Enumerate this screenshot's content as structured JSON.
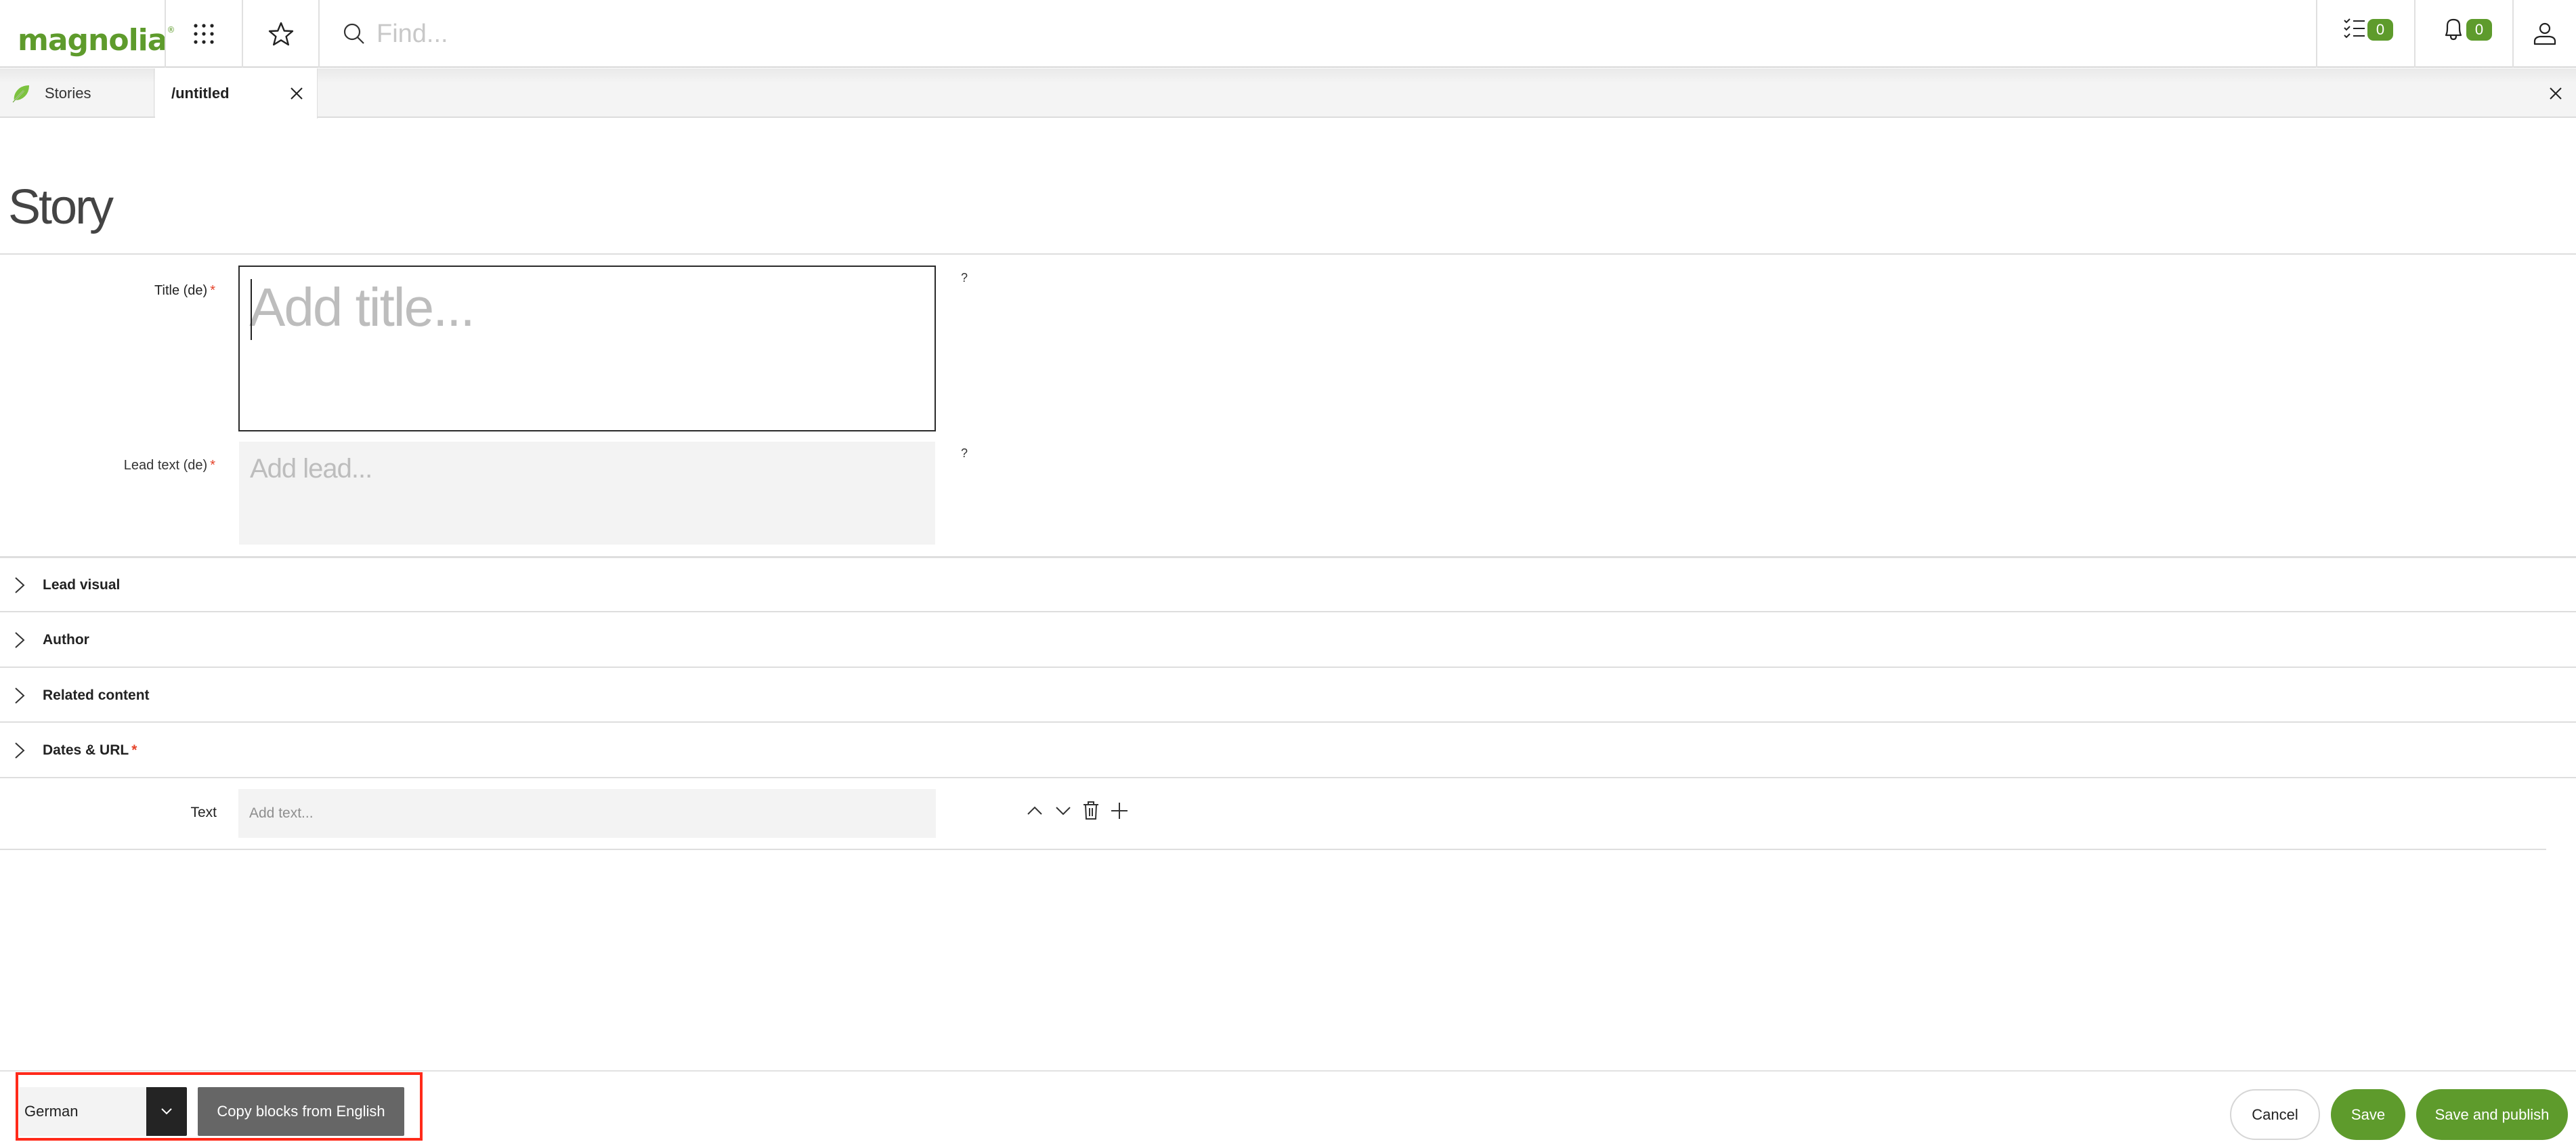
{
  "header": {
    "logo_text": "magnolia",
    "logo_mark": "®",
    "app_launcher_icon": "grid-dots-icon",
    "favorites_icon": "star-icon",
    "search": {
      "icon": "search-icon",
      "placeholder": "Find...",
      "value": ""
    },
    "tasks": {
      "icon": "task-list-icon",
      "count": "0"
    },
    "notifications": {
      "icon": "bell-icon",
      "count": "0"
    },
    "user_icon": "user-icon",
    "accent_color": "#5e9b2c"
  },
  "tabs": [
    {
      "label": "Stories",
      "icon": "leaf-icon",
      "active": false
    },
    {
      "label": "/untitled",
      "active": true,
      "closable": true
    }
  ],
  "tabbar_close_icon": "close-icon",
  "form": {
    "title": "Story",
    "fields": {
      "title": {
        "label": "Title (de)",
        "required": "*",
        "placeholder": "Add title...",
        "value": "",
        "help": "?"
      },
      "lead": {
        "label": "Lead text (de)",
        "required": "*",
        "placeholder": "Add lead...",
        "value": "",
        "help": "?"
      }
    },
    "sections": [
      {
        "label": "Lead visual",
        "required": ""
      },
      {
        "label": "Author",
        "required": ""
      },
      {
        "label": "Related content",
        "required": ""
      },
      {
        "label": "Dates & URL",
        "required": "*"
      }
    ],
    "blocks": [
      {
        "label": "Text",
        "placeholder": "Add text...",
        "value": "",
        "actions": [
          "move-up",
          "move-down",
          "delete",
          "add"
        ]
      }
    ]
  },
  "footer": {
    "language": {
      "selected": "German"
    },
    "copy_button": "Copy blocks from English",
    "cancel": "Cancel",
    "save": "Save",
    "save_publish": "Save and publish",
    "highlight_color": "#ff2a1a"
  }
}
